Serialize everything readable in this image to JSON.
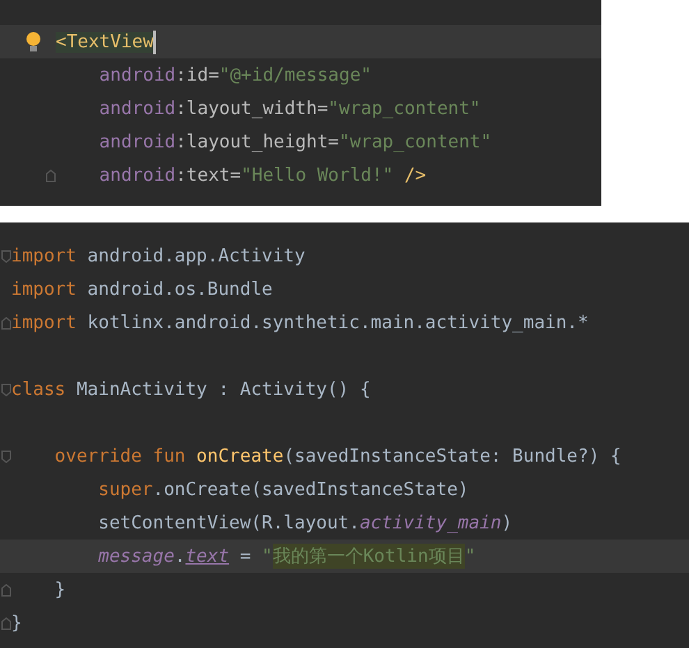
{
  "panels": [
    {
      "kind": "xml",
      "lines": [
        {
          "gutter": {
            "kind": "bulb"
          },
          "current": true,
          "cursor": true,
          "tokens": [
            {
              "kind": "tag",
              "text": "<TextView"
            }
          ]
        },
        {
          "current": false,
          "cursor": false,
          "tokens": [
            {
              "kind": "ns",
              "text": "    android"
            },
            {
              "kind": "attr",
              "text": ":id="
            },
            {
              "kind": "string",
              "text": "\"@+id/message\""
            }
          ]
        },
        {
          "current": false,
          "cursor": false,
          "tokens": [
            {
              "kind": "ns",
              "text": "    android"
            },
            {
              "kind": "attr",
              "text": ":layout_width="
            },
            {
              "kind": "string",
              "text": "\"wrap_content\""
            }
          ]
        },
        {
          "current": false,
          "cursor": false,
          "tokens": [
            {
              "kind": "ns",
              "text": "    android"
            },
            {
              "kind": "attr",
              "text": ":layout_height="
            },
            {
              "kind": "string",
              "text": "\"wrap_content\""
            }
          ]
        },
        {
          "gutter": {
            "kind": "fold-end"
          },
          "current": false,
          "cursor": false,
          "tokens": [
            {
              "kind": "ns",
              "text": "    android"
            },
            {
              "kind": "attr",
              "text": ":text="
            },
            {
              "kind": "string",
              "text": "\"Hello World!\""
            },
            {
              "kind": "tag",
              "text": " />"
            }
          ]
        }
      ]
    },
    {
      "kind": "kotlin",
      "lines": [
        {
          "gutter": {
            "kind": "fold-start"
          },
          "current": false,
          "cursor": false,
          "tokens": [
            {
              "kind": "keyword",
              "text": "import"
            },
            {
              "kind": "plain",
              "text": " android.app.Activity"
            }
          ]
        },
        {
          "current": false,
          "cursor": false,
          "tokens": [
            {
              "kind": "keyword",
              "text": "import"
            },
            {
              "kind": "plain",
              "text": " android.os.Bundle"
            }
          ]
        },
        {
          "gutter": {
            "kind": "fold-end"
          },
          "current": false,
          "cursor": false,
          "tokens": [
            {
              "kind": "keyword",
              "text": "import"
            },
            {
              "kind": "plain",
              "text": " kotlinx.android.synthetic.main.activity_main.*"
            }
          ]
        },
        {
          "kind": "blank"
        },
        {
          "gutter": {
            "kind": "fold-start"
          },
          "current": false,
          "cursor": false,
          "tokens": [
            {
              "kind": "keyword",
              "text": "class"
            },
            {
              "kind": "plain",
              "text": " MainActivity : Activity() {"
            }
          ]
        },
        {
          "kind": "blank"
        },
        {
          "gutter": {
            "kind": "fold-start"
          },
          "current": false,
          "cursor": false,
          "tokens": [
            {
              "kind": "keyword",
              "text": "    override fun"
            },
            {
              "kind": "function",
              "text": " onCreate"
            },
            {
              "kind": "plain",
              "text": "(savedInstanceState: Bundle?) {"
            }
          ]
        },
        {
          "current": false,
          "cursor": false,
          "tokens": [
            {
              "kind": "keyword",
              "text": "        super"
            },
            {
              "kind": "plain",
              "text": ".onCreate(savedInstanceState)"
            }
          ]
        },
        {
          "current": false,
          "cursor": false,
          "tokens": [
            {
              "kind": "plain",
              "text": "        setContentView(R.layout."
            },
            {
              "kind": "field",
              "text": "activity_main"
            },
            {
              "kind": "plain",
              "text": ")"
            }
          ]
        },
        {
          "current": true,
          "cursor": false,
          "tokens": [
            {
              "kind": "field",
              "text": "        message"
            },
            {
              "kind": "plain",
              "text": "."
            },
            {
              "kind": "synthetic",
              "text": "text"
            },
            {
              "kind": "plain",
              "text": " = "
            },
            {
              "kind": "string",
              "text": "\""
            },
            {
              "kind": "string-match",
              "text": "我的第一个Kotlin项目"
            },
            {
              "kind": "string",
              "text": "\""
            }
          ]
        },
        {
          "gutter": {
            "kind": "fold-end"
          },
          "current": false,
          "cursor": false,
          "tokens": [
            {
              "kind": "plain",
              "text": "    }"
            }
          ]
        },
        {
          "gutter": {
            "kind": "fold-end"
          },
          "current": false,
          "cursor": false,
          "tokens": [
            {
              "kind": "plain",
              "text": "}"
            }
          ]
        }
      ]
    }
  ]
}
